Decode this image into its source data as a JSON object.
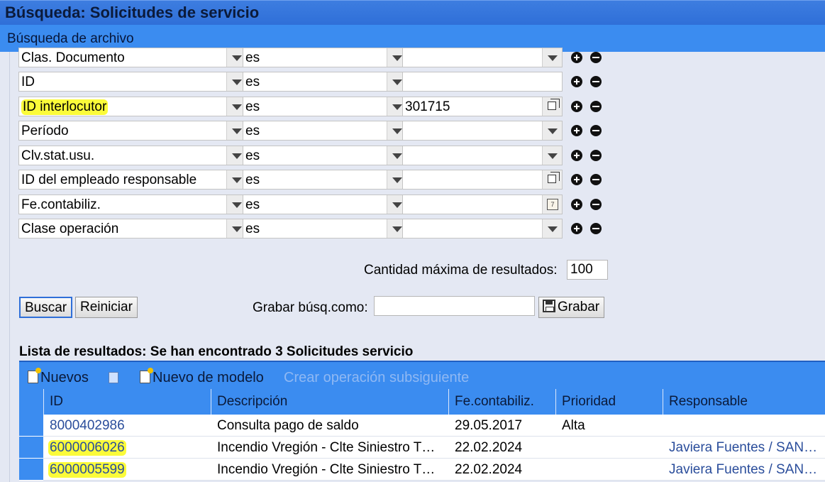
{
  "window": {
    "title": "Búsqueda: Solicitudes de servicio"
  },
  "search_panel": {
    "title": "Búsqueda de archivo",
    "criteria": [
      {
        "field": "Clas. Documento",
        "operator": "es",
        "value": "",
        "value_control": "dropdown"
      },
      {
        "field": "ID",
        "operator": "es",
        "value": "",
        "value_control": "text"
      },
      {
        "field": "ID interlocutor",
        "operator": "es",
        "value": "301715",
        "value_control": "lookup",
        "highlighted": true
      },
      {
        "field": "Período",
        "operator": "es",
        "value": "",
        "value_control": "dropdown"
      },
      {
        "field": "Clv.stat.usu.",
        "operator": "es",
        "value": "",
        "value_control": "dropdown"
      },
      {
        "field": "ID del empleado responsable",
        "operator": "es",
        "value": "",
        "value_control": "lookup"
      },
      {
        "field": "Fe.contabiliz.",
        "operator": "es",
        "value": "",
        "value_control": "calendar"
      },
      {
        "field": "Clase operación",
        "operator": "es",
        "value": "",
        "value_control": "dropdown"
      }
    ],
    "max_results_label": "Cantidad máxima de resultados:",
    "max_results_value": "100",
    "search_button": "Buscar",
    "reset_button": "Reiniciar",
    "save_as_label": "Grabar búsq.como:",
    "save_as_value": "",
    "save_button": "Grabar"
  },
  "results": {
    "title": "Lista de resultados: Se han encontrado 3 Solicitudes servicio",
    "toolbar": {
      "new_label": "Nuevos",
      "new_from_template_label": "Nuevo de modelo",
      "follow_up_label": "Crear operación subsiguiente"
    },
    "columns": [
      "ID",
      "Descripción",
      "Fe.contabiliz.",
      "Prioridad",
      "Responsable"
    ],
    "rows": [
      {
        "id": "8000402986",
        "description": "Consulta pago de saldo",
        "date": "29.05.2017",
        "priority": "Alta",
        "responsible": "",
        "highlighted": false
      },
      {
        "id": "6000006026",
        "description": "Incendio Vregión - Clte Siniestro T…",
        "date": "22.02.2024",
        "priority": "",
        "responsible": "Javiera Fuentes / SAN…",
        "highlighted": true
      },
      {
        "id": "6000005599",
        "description": "Incendio Vregión - Clte Siniestro T…",
        "date": "22.02.2024",
        "priority": "",
        "responsible": "Javiera Fuentes / SAN…",
        "highlighted": true
      }
    ]
  },
  "colors": {
    "accent": "#3b8cf0",
    "highlight": "#fbfb3a",
    "link": "#2a4d9b"
  }
}
